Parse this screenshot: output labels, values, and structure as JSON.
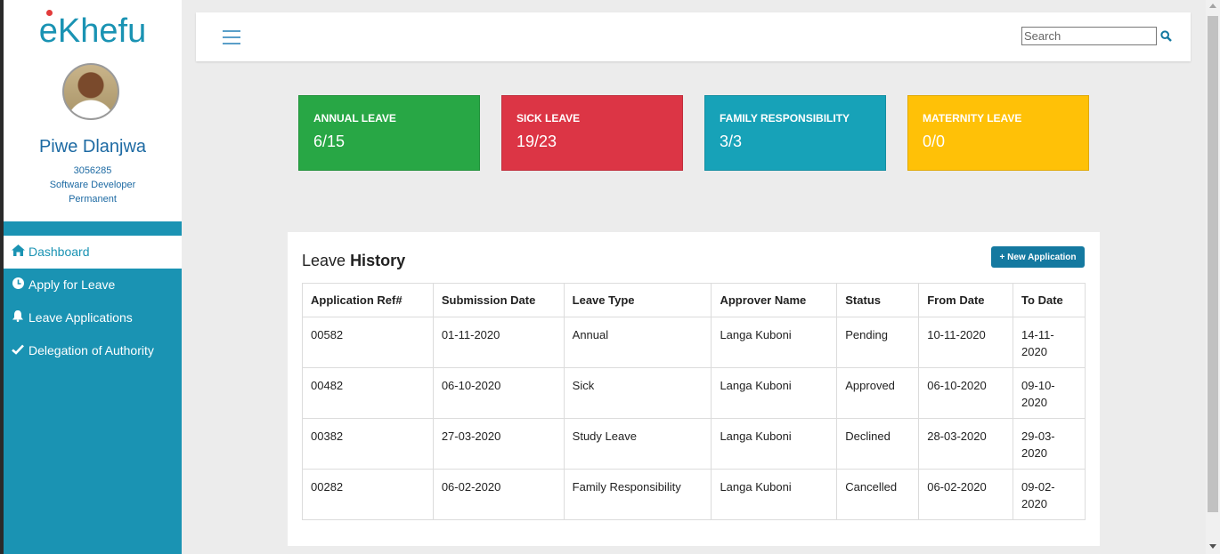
{
  "brand": {
    "logo_text": "eKhefu"
  },
  "profile": {
    "name": "Piwe Dlanjwa",
    "employee_number": "3056285",
    "job_title": "Software Developer",
    "employment_type": "Permanent"
  },
  "sidebar": {
    "items": [
      {
        "label": "Dashboard",
        "icon": "home-icon",
        "active": true
      },
      {
        "label": "Apply for Leave",
        "icon": "clock-icon"
      },
      {
        "label": "Leave Applications",
        "icon": "bell-icon"
      },
      {
        "label": "Delegation of Authority",
        "icon": "check-icon"
      }
    ]
  },
  "topbar": {
    "search_placeholder": "Search",
    "search_icon": "search-icon",
    "menu_icon": "hamburger-icon"
  },
  "cards": [
    {
      "title": "ANNUAL LEAVE",
      "value": "6/15",
      "color": "#28a745"
    },
    {
      "title": "SICK LEAVE",
      "value": "19/23",
      "color": "#dc3545"
    },
    {
      "title": "FAMILY RESPONSIBILITY",
      "value": "3/3",
      "color": "#17a2b8"
    },
    {
      "title": "MATERNITY LEAVE",
      "value": "0/0",
      "color": "#ffc107"
    }
  ],
  "history": {
    "title_prefix": "Leave",
    "title_bold": "History",
    "new_button": "+ New Application",
    "columns": [
      "Application Ref#",
      "Submission Date",
      "Leave Type",
      "Approver Name",
      "Status",
      "From Date",
      "To Date"
    ],
    "rows": [
      [
        "00582",
        "01-11-2020",
        "Annual",
        "Langa Kuboni",
        "Pending",
        "10-11-2020",
        "14-11-2020"
      ],
      [
        "00482",
        "06-10-2020",
        "Sick",
        "Langa Kuboni",
        "Approved",
        "06-10-2020",
        "09-10-2020"
      ],
      [
        "00382",
        "27-03-2020",
        "Study Leave",
        "Langa Kuboni",
        "Declined",
        "28-03-2020",
        "29-03-2020"
      ],
      [
        "00282",
        "06-02-2020",
        "Family Responsibility",
        "Langa Kuboni",
        "Cancelled",
        "06-02-2020",
        "09-02-2020"
      ]
    ]
  },
  "colors": {
    "sidebar": "#1a93b3",
    "accent_text": "#1d6aa3",
    "button": "#1479a0"
  }
}
